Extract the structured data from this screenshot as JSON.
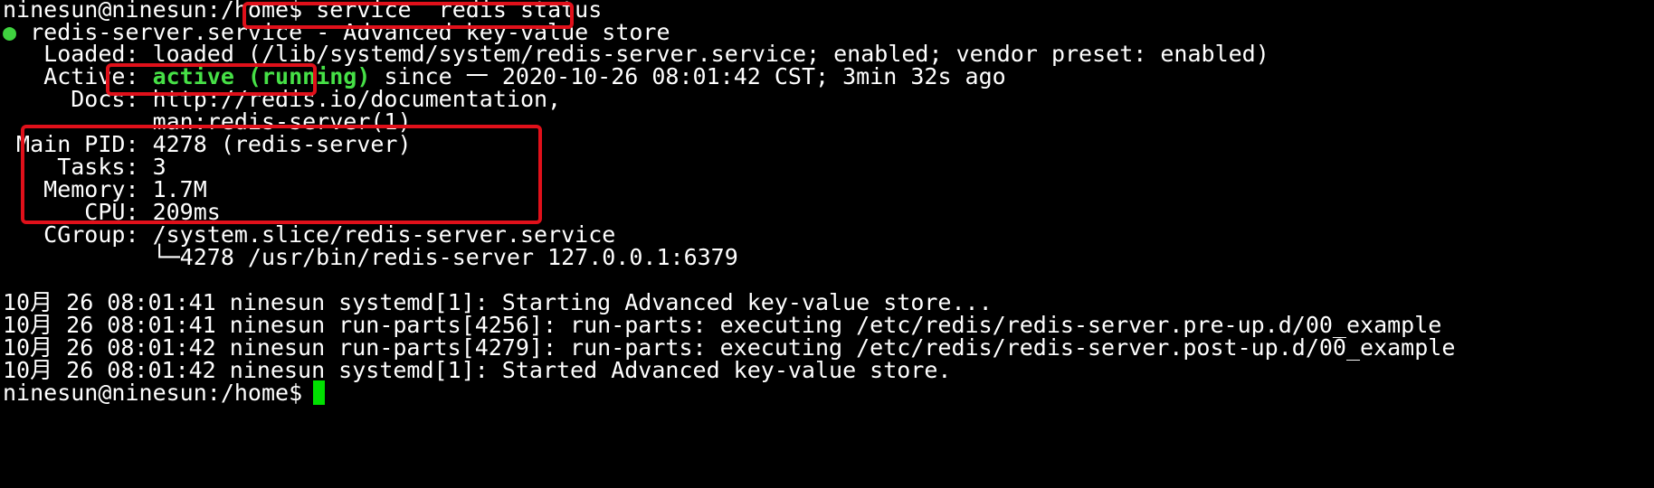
{
  "terminal": {
    "prompt_line": {
      "prompt": "ninesun@ninesun:/home$",
      "command": " service  redis status"
    },
    "status_line": {
      "bullet": "●",
      "text": " redis-server.service - Advanced key-value store"
    },
    "loaded_line": "   Loaded: loaded (/lib/systemd/system/redis-server.service; enabled; vendor preset: enabled)",
    "active_line": {
      "prefix": "   Active: ",
      "state": "active (running)",
      "suffix": " since 一 2020-10-26 08:01:42 CST; 3min 32s ago"
    },
    "docs_line_1": "     Docs: http://redis.io/documentation,",
    "docs_line_2": "           man:redis-server(1)",
    "pid_line": " Main PID: 4278 (redis-server)",
    "tasks_line": "    Tasks: 3",
    "memory_line": "   Memory: 1.7M",
    "cpu_line": "      CPU: 209ms",
    "cgroup_line_1": "   CGroup: /system.slice/redis-server.service",
    "cgroup_line_2": "           └─4278 /usr/bin/redis-server 127.0.0.1:6379",
    "logs": [
      "10月 26 08:01:41 ninesun systemd[1]: Starting Advanced key-value store...",
      "10月 26 08:01:41 ninesun run-parts[4256]: run-parts: executing /etc/redis/redis-server.pre-up.d/00_example",
      "10月 26 08:01:42 ninesun run-parts[4279]: run-parts: executing /etc/redis/redis-server.post-up.d/00_example",
      "10月 26 08:01:42 ninesun systemd[1]: Started Advanced key-value store."
    ],
    "final_prompt": "ninesun@ninesun:/home$"
  },
  "colors": {
    "background": "#000000",
    "text": "#ffffff",
    "running": "#46e046",
    "cursor": "#00e000",
    "highlight": "#e0101a"
  }
}
